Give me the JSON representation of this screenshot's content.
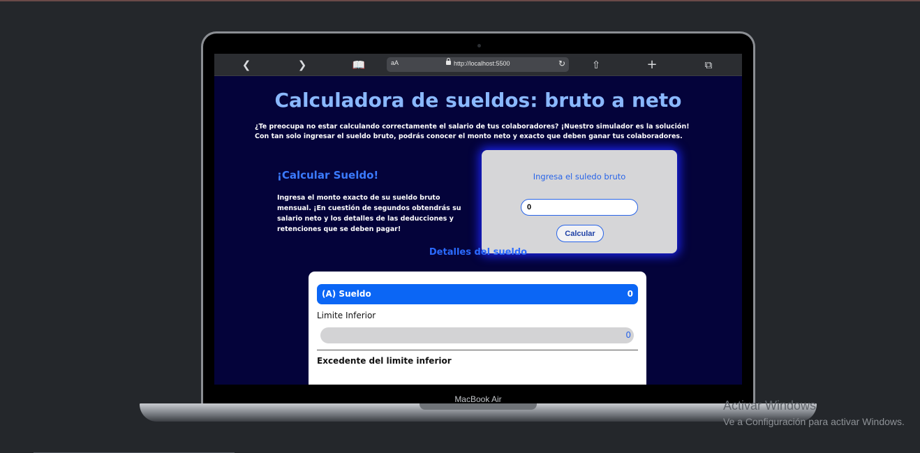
{
  "browser": {
    "text_size_label": "aA",
    "url": "http://localhost:5500"
  },
  "page": {
    "title": "Calculadora de sueldos: bruto a neto",
    "intro": "¿Te preocupa no estar calculando correctamente el salario de tus colaboradores? ¡Nuestro simulador es la solución! Con tan solo ingresar el sueldo bruto, podrás conocer el monto neto y exacto que deben ganar tus colaboradores.",
    "calc_heading": "¡Calcular Sueldo!",
    "calc_description": "Ingresa el monto exacto de su sueldo bruto mensual. ¡En cuestión de segundos obtendrás su salario neto y los detalles de las deducciones y retenciones que se deben pagar!",
    "input_label": "Ingresa el suledo bruto",
    "input_value": "0",
    "calc_button": "Calcular",
    "details_heading": "Detalles del sueldo",
    "details": {
      "sueldo_label": "(A) Sueldo",
      "sueldo_value": "0",
      "limite_label": "Limite Inferior",
      "limite_value": "0",
      "excedente_label": "Excedente del limite inferior"
    }
  },
  "device": {
    "model": "MacBook Air"
  },
  "watermark": {
    "title": "Activar Windows",
    "subtitle": "Ve a Configuración para activar Windows."
  }
}
